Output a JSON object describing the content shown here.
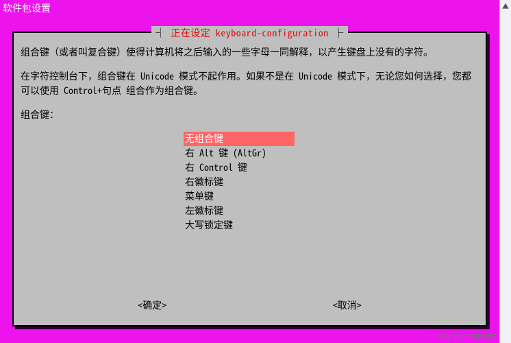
{
  "window": {
    "title": "软件包设置"
  },
  "dialog": {
    "title": "正在设定 keyboard-configuration",
    "para1": "组合键（或者叫复合键）使得计算机将之后输入的一些字母一同解释，以产生键盘上没有的字符。",
    "para2": "在字符控制台下，组合键在 Unicode 模式不起作用。如果不是在 Unicode 模式下，无论您如何选择，您都可以使用 Control+句点 组合作为组合键。",
    "prompt": "组合键：",
    "options": [
      "无组合键",
      "右 Alt 键 (AltGr)",
      "右 Control 键",
      "右徽标键",
      "菜单键",
      "左徽标键",
      "大写锁定键"
    ],
    "selected_index": 0,
    "ok": "<确定>",
    "cancel": "<取消>"
  },
  "watermark": "CSDN @yangtsejin"
}
